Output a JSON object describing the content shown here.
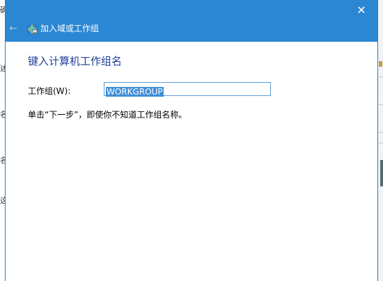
{
  "window": {
    "title": "加入域或工作组",
    "close_glyph": "✕",
    "back_glyph": "←"
  },
  "main": {
    "heading": "键入计算机工作组名",
    "workgroup_label": "工作组(W):",
    "workgroup_value": "WORKGROUP",
    "hint": "单击“下一步”，即使你不知道工作组名称。"
  },
  "background": {
    "left_chars": [
      "确",
      "述",
      "名",
      "名",
      "这"
    ]
  },
  "colors": {
    "titlebar": "#2b87d4",
    "heading": "#1f3d9a",
    "selection": "#3f8fd8"
  }
}
